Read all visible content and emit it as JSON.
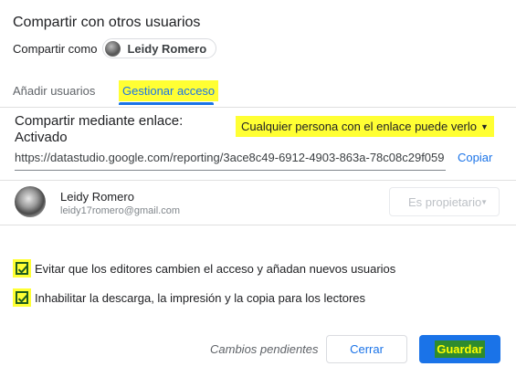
{
  "dialog": {
    "title": "Compartir con otros usuarios",
    "share_as_label": "Compartir como",
    "owner_chip_name": "Leidy Romero"
  },
  "tabs": [
    {
      "label": "Añadir usuarios",
      "active": false
    },
    {
      "label": "Gestionar acceso",
      "active": true
    }
  ],
  "link_sharing": {
    "label": "Compartir mediante enlace: Activado",
    "mode": "Cualquier persona con el enlace puede verlo",
    "url": "https://datastudio.google.com/reporting/3ace8c49-6912-4903-863a-78c08c29f059",
    "copy_label": "Copiar"
  },
  "users": [
    {
      "name": "Leidy Romero",
      "email": "leidy17romero@gmail.com",
      "role": "Es propietario"
    }
  ],
  "options": [
    {
      "label": "Evitar que los editores cambien el acceso y añadan nuevos usuarios",
      "checked": true
    },
    {
      "label": "Inhabilitar la descarga, la impresión y la copia para los lectores",
      "checked": true
    }
  ],
  "footer": {
    "status": "Cambios pendientes",
    "cancel_label": "Cerrar",
    "save_label": "Guardar"
  },
  "colors": {
    "accent": "#1a73e8",
    "highlight": "#ffff33",
    "save_highlight": "#2e8b2e"
  }
}
